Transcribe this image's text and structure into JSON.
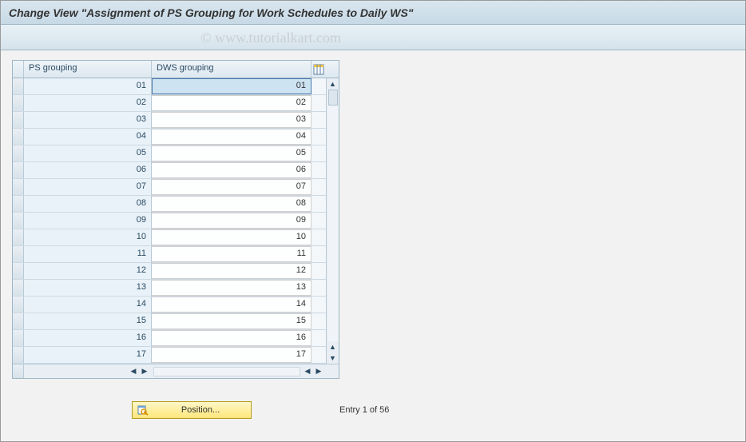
{
  "title": "Change View \"Assignment of PS Grouping for Work Schedules to Daily WS\"",
  "watermark": "© www.tutorialkart.com",
  "table": {
    "headers": {
      "ps": "PS grouping",
      "dws": "DWS grouping"
    },
    "config_icon": "table-settings-icon",
    "rows": [
      {
        "ps": "01",
        "dws": "01"
      },
      {
        "ps": "02",
        "dws": "02"
      },
      {
        "ps": "03",
        "dws": "03"
      },
      {
        "ps": "04",
        "dws": "04"
      },
      {
        "ps": "05",
        "dws": "05"
      },
      {
        "ps": "06",
        "dws": "06"
      },
      {
        "ps": "07",
        "dws": "07"
      },
      {
        "ps": "08",
        "dws": "08"
      },
      {
        "ps": "09",
        "dws": "09"
      },
      {
        "ps": "10",
        "dws": "10"
      },
      {
        "ps": "11",
        "dws": "11"
      },
      {
        "ps": "12",
        "dws": "12"
      },
      {
        "ps": "13",
        "dws": "13"
      },
      {
        "ps": "14",
        "dws": "14"
      },
      {
        "ps": "15",
        "dws": "15"
      },
      {
        "ps": "16",
        "dws": "16"
      },
      {
        "ps": "17",
        "dws": "17"
      }
    ]
  },
  "footer": {
    "position_label": "Position...",
    "entry_text": "Entry 1 of 56"
  }
}
